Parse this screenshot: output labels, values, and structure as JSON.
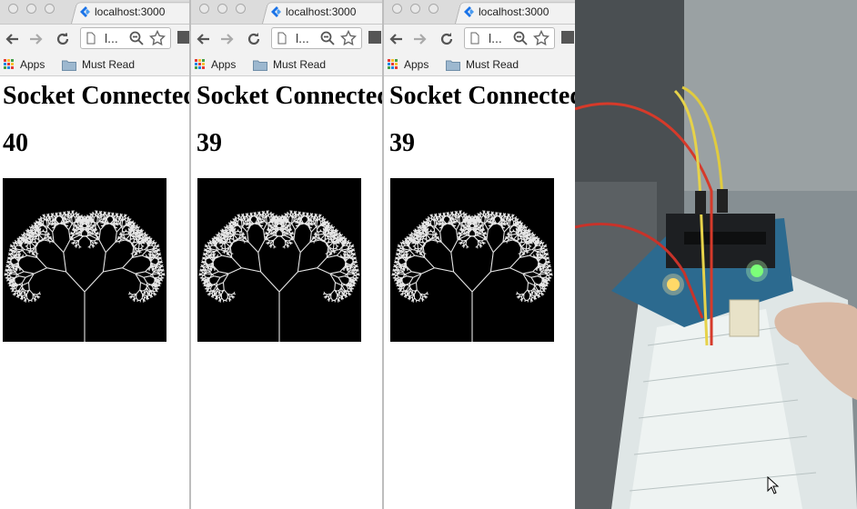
{
  "windows": [
    {
      "tab_title": "localhost:3000",
      "url_text": "l...",
      "bookmarks": [
        "Apps",
        "Must Read"
      ],
      "heading": "Socket Connected",
      "count": "40"
    },
    {
      "tab_title": "localhost:3000",
      "url_text": "l...",
      "bookmarks": [
        "Apps",
        "Must Read"
      ],
      "heading": "Socket Connected",
      "count": "39"
    },
    {
      "tab_title": "localhost:3000",
      "url_text": "l...",
      "bookmarks": [
        "Apps",
        "Must Read"
      ],
      "heading": "Socket Connected",
      "count": "39"
    }
  ],
  "icons": {
    "favicon": "localhost-favicon-icon",
    "back": "back-arrow-icon",
    "forward": "forward-arrow-icon",
    "reload": "reload-icon",
    "page": "page-icon",
    "zoom": "zoom-out-icon",
    "star": "bookmark-star-icon",
    "apps": "apps-grid-icon",
    "folder": "folder-icon",
    "cursor": "mouse-cursor-icon"
  },
  "colors": {
    "chrome_bg": "#f2f2f2",
    "titlebar_bg": "#dcdcdc",
    "tree_bg": "#000000",
    "tree_stroke": "#e6e6e6",
    "favicon_blue": "#1a73e8"
  }
}
